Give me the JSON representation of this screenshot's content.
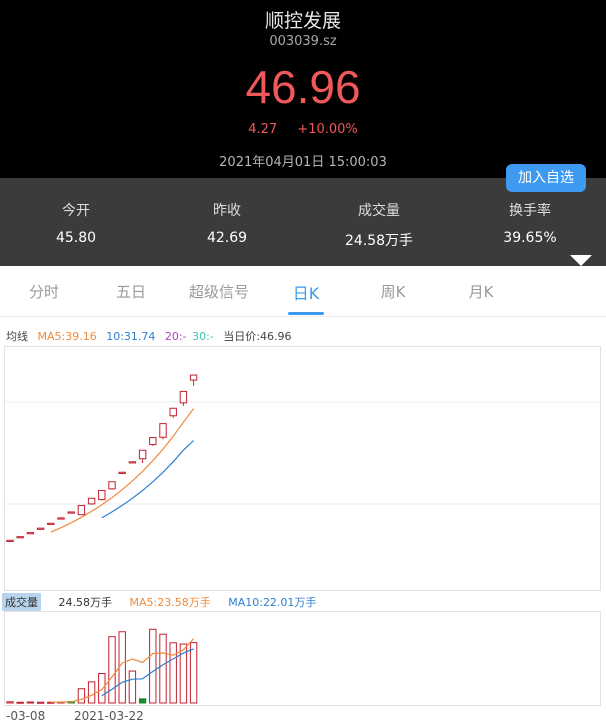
{
  "header": {
    "name": "顺控发展",
    "code": "003039.sz",
    "price": "46.96",
    "change": "4.27",
    "change_pct": "+10.00%",
    "time": "2021年04月01日 15:00:03",
    "watch_label": "加入自选"
  },
  "stats": [
    {
      "label": "今开",
      "value": "45.80"
    },
    {
      "label": "昨收",
      "value": "42.69"
    },
    {
      "label": "成交量",
      "value": "24.58万手"
    },
    {
      "label": "换手率",
      "value": "39.65%"
    }
  ],
  "tabs": [
    "分时",
    "五日",
    "超级信号",
    "日K",
    "周K",
    "月K"
  ],
  "active_tab": "日K",
  "ma_legend": {
    "label": "均线",
    "ma5": "MA5:39.16",
    "ma10": "10:31.74",
    "ma20": "20:-",
    "ma30": "30:-",
    "current": "当日价:46.96"
  },
  "volume_legend": {
    "tag": "成交量",
    "volume": "24.58万手",
    "ma5": "MA5:23.58万手",
    "ma10": "MA10:22.01万手"
  },
  "dates": [
    "-03-08",
    "2021-03-22"
  ],
  "colors": {
    "up": "#c0202f",
    "down": "#1e8a2e",
    "ma5": "#f08a3c",
    "ma10": "#2d7fd2",
    "ma20": "#b040c8",
    "ma30": "#3ec6b0",
    "accent": "#3d9af0"
  },
  "chart_data": {
    "type": "candlestick",
    "candles": [
      {
        "o": 8.54,
        "c": 8.54,
        "h": 8.54,
        "l": 8.54
      },
      {
        "o": 9.39,
        "c": 9.39,
        "h": 9.39,
        "l": 9.39
      },
      {
        "o": 10.33,
        "c": 10.33,
        "h": 10.33,
        "l": 10.33
      },
      {
        "o": 11.36,
        "c": 11.36,
        "h": 11.36,
        "l": 11.36
      },
      {
        "o": 12.5,
        "c": 12.5,
        "h": 12.5,
        "l": 12.5
      },
      {
        "o": 13.75,
        "c": 13.75,
        "h": 13.75,
        "l": 13.75
      },
      {
        "o": 15.13,
        "c": 15.13,
        "h": 15.13,
        "l": 15.13
      },
      {
        "o": 14.5,
        "c": 16.64,
        "h": 16.64,
        "l": 14.5
      },
      {
        "o": 17.0,
        "c": 18.3,
        "h": 18.3,
        "l": 16.8
      },
      {
        "o": 18.0,
        "c": 20.13,
        "h": 20.13,
        "l": 17.8
      },
      {
        "o": 20.5,
        "c": 22.14,
        "h": 22.14,
        "l": 20.3
      },
      {
        "o": 24.36,
        "c": 24.36,
        "h": 24.36,
        "l": 24.36
      },
      {
        "o": 26.8,
        "c": 26.8,
        "h": 26.8,
        "l": 26.8
      },
      {
        "o": 27.5,
        "c": 29.48,
        "h": 29.48,
        "l": 26.5
      },
      {
        "o": 30.8,
        "c": 32.43,
        "h": 32.43,
        "l": 30.5
      },
      {
        "o": 32.5,
        "c": 35.67,
        "h": 35.67,
        "l": 32.0
      },
      {
        "o": 37.5,
        "c": 39.24,
        "h": 39.24,
        "l": 37.0
      },
      {
        "o": 40.5,
        "c": 43.16,
        "h": 43.16,
        "l": 39.8
      },
      {
        "o": 45.8,
        "c": 46.96,
        "h": 46.96,
        "l": 44.5
      }
    ],
    "ma5": [
      null,
      null,
      null,
      null,
      10.42,
      11.47,
      12.61,
      13.88,
      15.26,
      16.79,
      18.47,
      20.31,
      22.35,
      24.58,
      27.04,
      29.75,
      32.72,
      35.99,
      39.16
    ],
    "ma10": [
      null,
      null,
      null,
      null,
      null,
      null,
      null,
      null,
      null,
      13.75,
      15.13,
      16.64,
      18.3,
      20.13,
      22.14,
      24.36,
      26.8,
      29.48,
      31.74
    ],
    "volume": [
      0.5,
      0.3,
      0.4,
      0.3,
      0.3,
      0.4,
      0.6,
      5.8,
      8.6,
      12.0,
      27.0,
      29.0,
      13.0,
      1.7,
      30.0,
      28.0,
      24.5,
      24.0,
      24.58
    ],
    "volume_ma5": [
      null,
      null,
      null,
      null,
      0.36,
      0.34,
      0.4,
      1.52,
      3.14,
      5.48,
      10.6,
      16.28,
      17.92,
      16.54,
      20.14,
      20.34,
      19.44,
      21.64,
      26.22
    ],
    "volume_ma10": [
      null,
      null,
      null,
      null,
      null,
      null,
      null,
      null,
      null,
      2.92,
      5.57,
      8.44,
      9.7,
      9.84,
      12.81,
      15.57,
      17.96,
      20.3,
      22.01
    ],
    "price_range": [
      0,
      50
    ],
    "volume_range": [
      0,
      35
    ]
  }
}
